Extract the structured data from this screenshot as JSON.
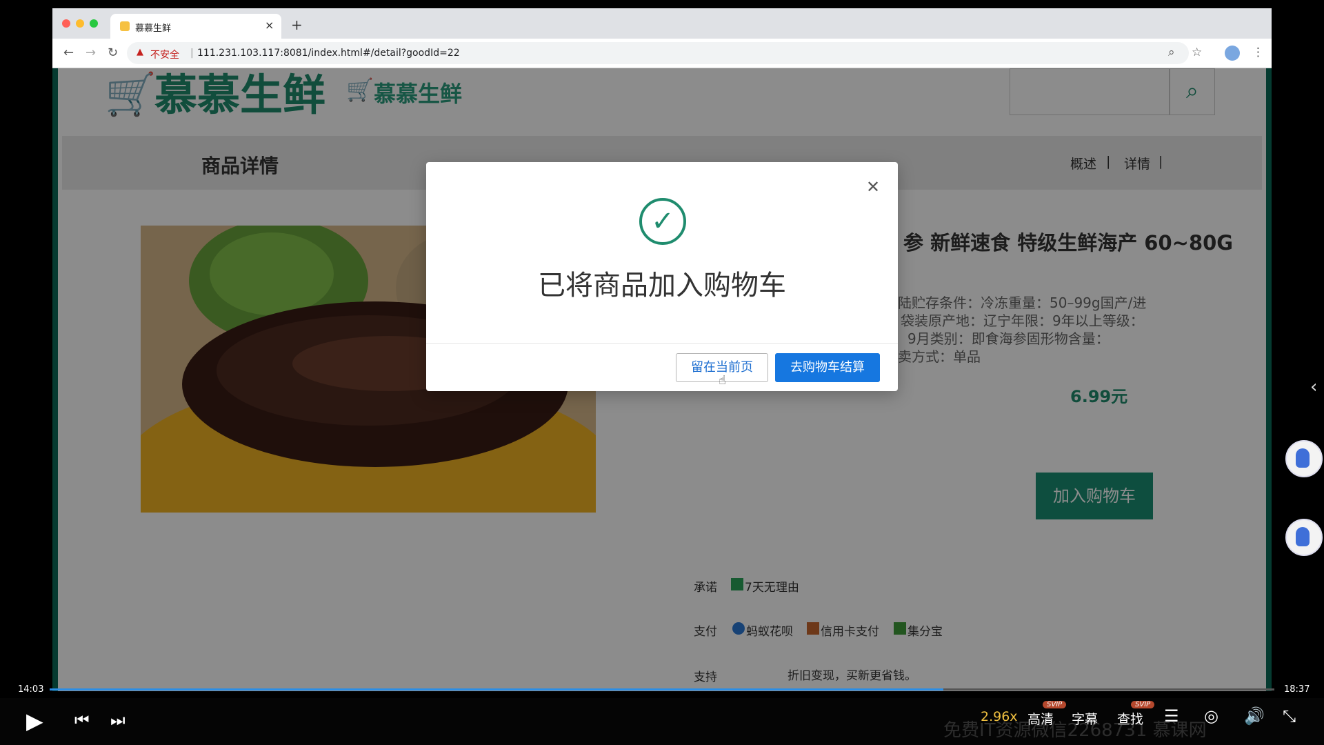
{
  "browser": {
    "tab_title": "慕慕生鲜",
    "tab_close": "×",
    "new_tab": "+",
    "not_secure": "不安全",
    "url": "111.231.103.117:8081/index.html#/detail?goodId=22"
  },
  "site": {
    "logo_text": "慕慕生鲜",
    "logo_text_small": "慕慕生鲜",
    "section_title": "商品详情",
    "nav": [
      "概述",
      "详情"
    ],
    "product_name": "参 新鲜速食 特级生鲜海产 60~80G",
    "specs": [
      "陆贮存条件：冷冻重量：50–99g国产/进",
      "袋装原产地：辽宁年限：9年以上等级：",
      "9月类别：即食海参固形物含量：",
      "卖方式：单品"
    ],
    "price": "6.99元",
    "add_cart": "加入购物车",
    "promise_label": "承诺",
    "promise_text": "7天无理由",
    "pay_label": "支付",
    "pay_methods": [
      "蚂蚁花呗",
      "信用卡支付",
      "集分宝"
    ],
    "support_label": "支持",
    "support_text": "折旧变现，买新更省钱。"
  },
  "modal": {
    "title": "已将商品加入购物车",
    "stay_label": "留在当前页",
    "checkout_label": "去购物车结算"
  },
  "player": {
    "time_current": "14:03",
    "time_total": "18:37",
    "progress": 0.73,
    "speed": "2.96x",
    "quality": "高清",
    "subtitles": "字幕",
    "search": "查找",
    "svip": "SVIP",
    "watermark": "免费IT资源微信2268731   慕课网"
  },
  "colors": {
    "brand_green": "#1f8c6e",
    "primary_blue": "#1677e0",
    "progress_blue": "#2b8ee6"
  },
  "icons": [
    "search-icon",
    "check-icon",
    "close-icon",
    "play-icon",
    "skip-back-icon",
    "skip-forward-icon",
    "list-icon",
    "settings-icon",
    "volume-icon",
    "exit-fullscreen-icon"
  ]
}
